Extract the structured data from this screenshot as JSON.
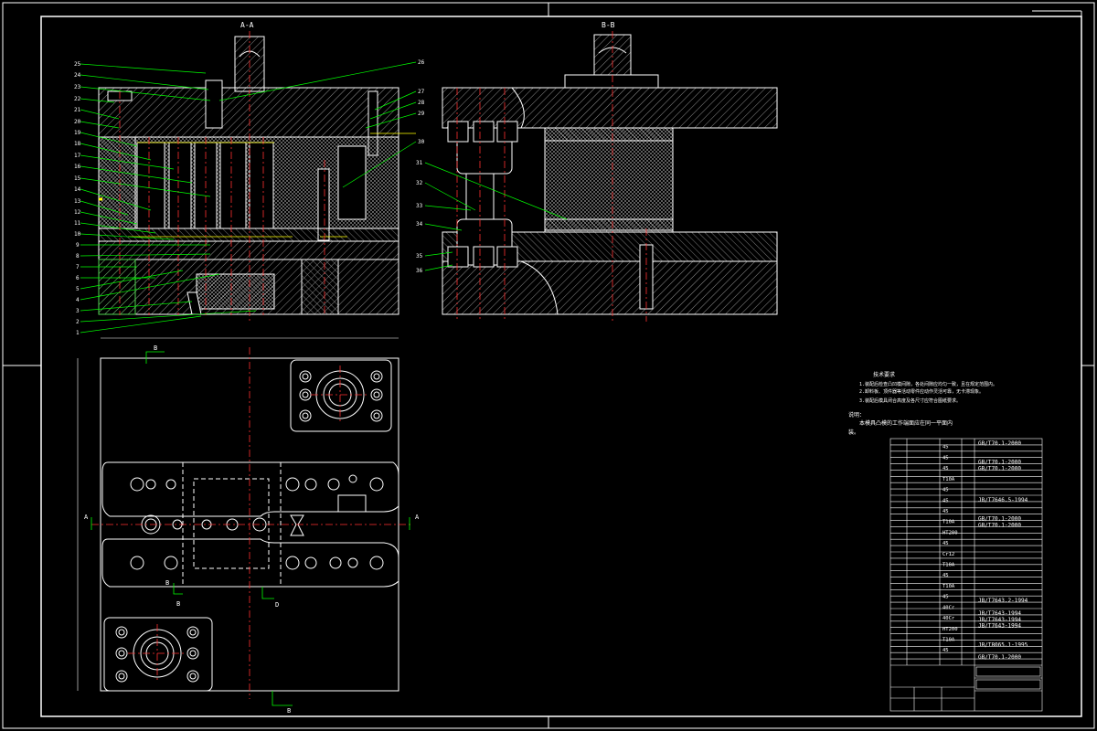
{
  "drawing": {
    "section_a_label": "A-A",
    "section_b_label": "B-B",
    "plan_markers": {
      "a": "A",
      "b": "B",
      "d": "D"
    },
    "notes": {
      "heading": "技术要求",
      "line1": "1.装配后检查凸凹模间隙，各处间隙应均匀一致，且在规定范围内。",
      "line2": "2.卸料板、顶件器等活动零件应动作灵活可靠，无卡滞现象。",
      "line3": "3.装配后模具闭合高度及各尺寸应符合图纸要求。",
      "remark_title": "说明：",
      "remark_body": "本模具凸模的工作端面应在同一平面内",
      "remark_body2": "装。"
    },
    "bom": {
      "standards": [
        "GB/T70.1-2000",
        "GB/T70.1-2000",
        "GB/T70.1-2000",
        "JB/T7646.5-1994",
        "GB/T70.1-2000",
        "GB/T70.1-2000",
        "JB/T7643.2-1994",
        "JB/T7643-1994",
        "JB/T7643-1994",
        "JB/T7643-1994",
        "JB/T8065.1-1995",
        "GB/T70.1-2000"
      ],
      "materials": [
        "45",
        "45",
        "45",
        "T10A",
        "45",
        "45",
        "45",
        "T10A",
        "HT200",
        "45",
        "Cr12",
        "T10A",
        "45",
        "T10A",
        "45",
        "40Cr",
        "40Cr",
        "HT200",
        "T10A",
        "45"
      ]
    }
  },
  "colors": {
    "frame": "#ffffff",
    "section_lines": "#ffffff",
    "centerline": "#ff3030",
    "leader": "#00ff00",
    "dimension": "#ffff00",
    "hatch": "#ffffff"
  }
}
